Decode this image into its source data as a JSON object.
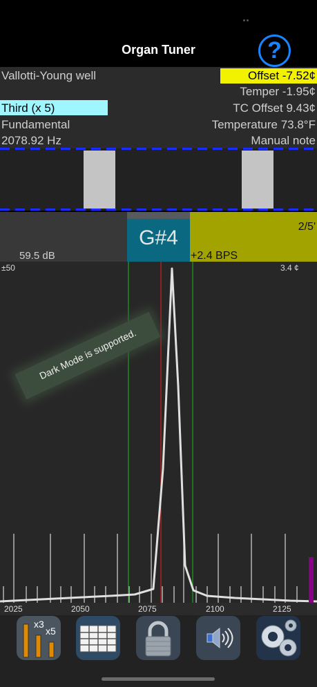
{
  "header": {
    "title": "Organ Tuner",
    "help_label": "?"
  },
  "info": {
    "temperament": "Vallotti-Young well",
    "offset": "Offset  -7.52¢",
    "temper": "Temper  -1.95¢",
    "partial": "Third (x 5)",
    "tc_offset": "TC Offset 9.43¢",
    "mode": "Fundamental",
    "temperature": "Temperature 73.8°F",
    "frequency": "2078.92 Hz",
    "note_mode": "Manual note"
  },
  "status": {
    "level": "59.5 dB",
    "note": "G#4",
    "ratio": "2/5'",
    "beats": "+2.4 BPS"
  },
  "graph": {
    "range": "±50",
    "cents": "3.4 ¢",
    "axis_ticks": [
      "2025",
      "2050",
      "2075",
      "2100",
      "2125"
    ]
  },
  "banner": {
    "text": "Dark Mode is supported."
  },
  "toolbar": {
    "items": [
      {
        "icon": "partials-bars-icon",
        "x3": "x3",
        "x5": "x5"
      },
      {
        "icon": "grid-table-icon"
      },
      {
        "icon": "padlock-icon"
      },
      {
        "icon": "speaker-icon"
      },
      {
        "icon": "gears-icon"
      }
    ]
  },
  "colors": {
    "accent_blue": "#1a84ff",
    "offset_yellow": "#f2f200",
    "partial_cyan": "#9ff6ff",
    "note_teal": "#0a6980",
    "bps_olive": "#a3a300",
    "spectrum_line": "#e0e0e0",
    "target_green": "#1aa31a",
    "target_red": "#d02020",
    "level_magenta": "#8a0088"
  }
}
